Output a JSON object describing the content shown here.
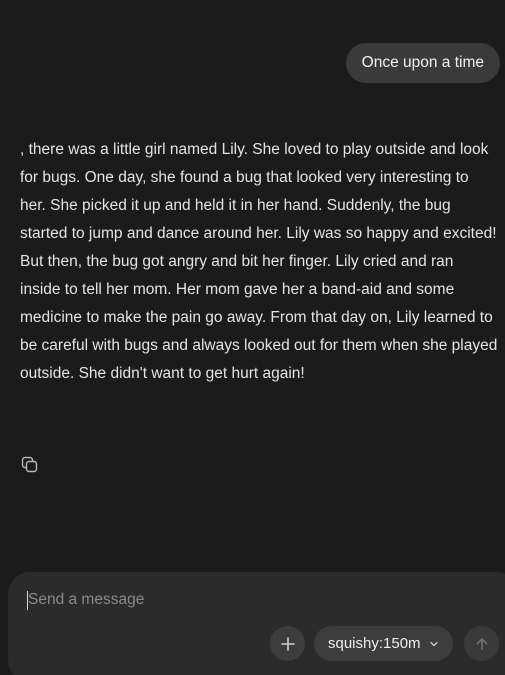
{
  "conversation": {
    "user_message": "Once upon a time",
    "assistant_message": ", there was a little girl named Lily. She loved to play outside and look for bugs. One day, she found a bug that looked very interesting to her. She picked it up and held it in her hand. Suddenly, the bug started to jump and dance around her. Lily was so happy and excited! But then, the bug got angry and bit her finger. Lily cried and ran inside to tell her mom. Her mom gave her a band-aid and some medicine to make the pain go away. From that day on, Lily learned to be careful with bugs and always looked out for them when she played outside. She didn't want to get hurt again!"
  },
  "composer": {
    "input_value": "",
    "placeholder": "Send a message",
    "model_label": "squishy:150m"
  },
  "icons": {
    "copy": "copy-icon",
    "add": "plus-icon",
    "model_dropdown": "chevron-down-icon",
    "send": "arrow-up-icon"
  },
  "colors": {
    "background": "#1b1b1b",
    "user_bubble": "#3a3a3a",
    "composer": "#2b2b2b",
    "button": "#3d3d3d"
  }
}
